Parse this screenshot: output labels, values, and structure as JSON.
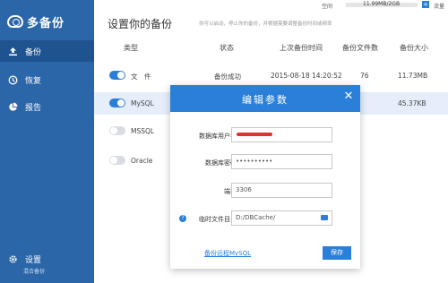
{
  "app": {
    "logo_text": "多备份"
  },
  "sidebar": {
    "items": [
      {
        "label": "备份",
        "icon": "upload-icon"
      },
      {
        "label": "恢复",
        "icon": "history-icon"
      },
      {
        "label": "报告",
        "icon": "pie-chart-icon"
      }
    ],
    "settings_label": "设置",
    "footnote": "混合备份"
  },
  "topbar": {
    "space_label": "空间",
    "space_value": "11.99MB/2GB",
    "plus_label": "+",
    "flow_label": "流量"
  },
  "main": {
    "title": "设置你的备份",
    "subtitle": "你可以启动，停止你的备份，并根据需要调整备份时间或频率",
    "columns": [
      "类型",
      "状态",
      "上次备份时间",
      "备份文件数",
      "备份大小"
    ],
    "rows": [
      {
        "type": "文　件",
        "status": "备份成功",
        "last_backup": "2015-08-18 14:20:52",
        "file_count": "76",
        "size": "11.73MB",
        "enabled": true
      },
      {
        "type": "MySQL",
        "status": "",
        "last_backup": "",
        "file_count": "",
        "size": "45.37KB",
        "enabled": true
      },
      {
        "type": "MSSQL",
        "status": "",
        "last_backup": "",
        "file_count": "",
        "size": "",
        "enabled": false
      },
      {
        "type": "Oracle",
        "status": "",
        "last_backup": "",
        "file_count": "",
        "size": "",
        "enabled": false
      }
    ]
  },
  "dialog": {
    "title": "编辑参数",
    "close_label": "✕",
    "username_label": "数据库用户名",
    "username_value": "",
    "password_label": "数据库密码",
    "password_value": "••••••••••",
    "port_label": "端口",
    "port_value": "3306",
    "temp_dir_label": "临时文件目录",
    "temp_dir_value": "D:/DBCache/",
    "remote_link": "备份远程MySQL",
    "save_label": "保存"
  },
  "colors": {
    "sidebar": "#2a66a8",
    "accent": "#2a80d8"
  }
}
